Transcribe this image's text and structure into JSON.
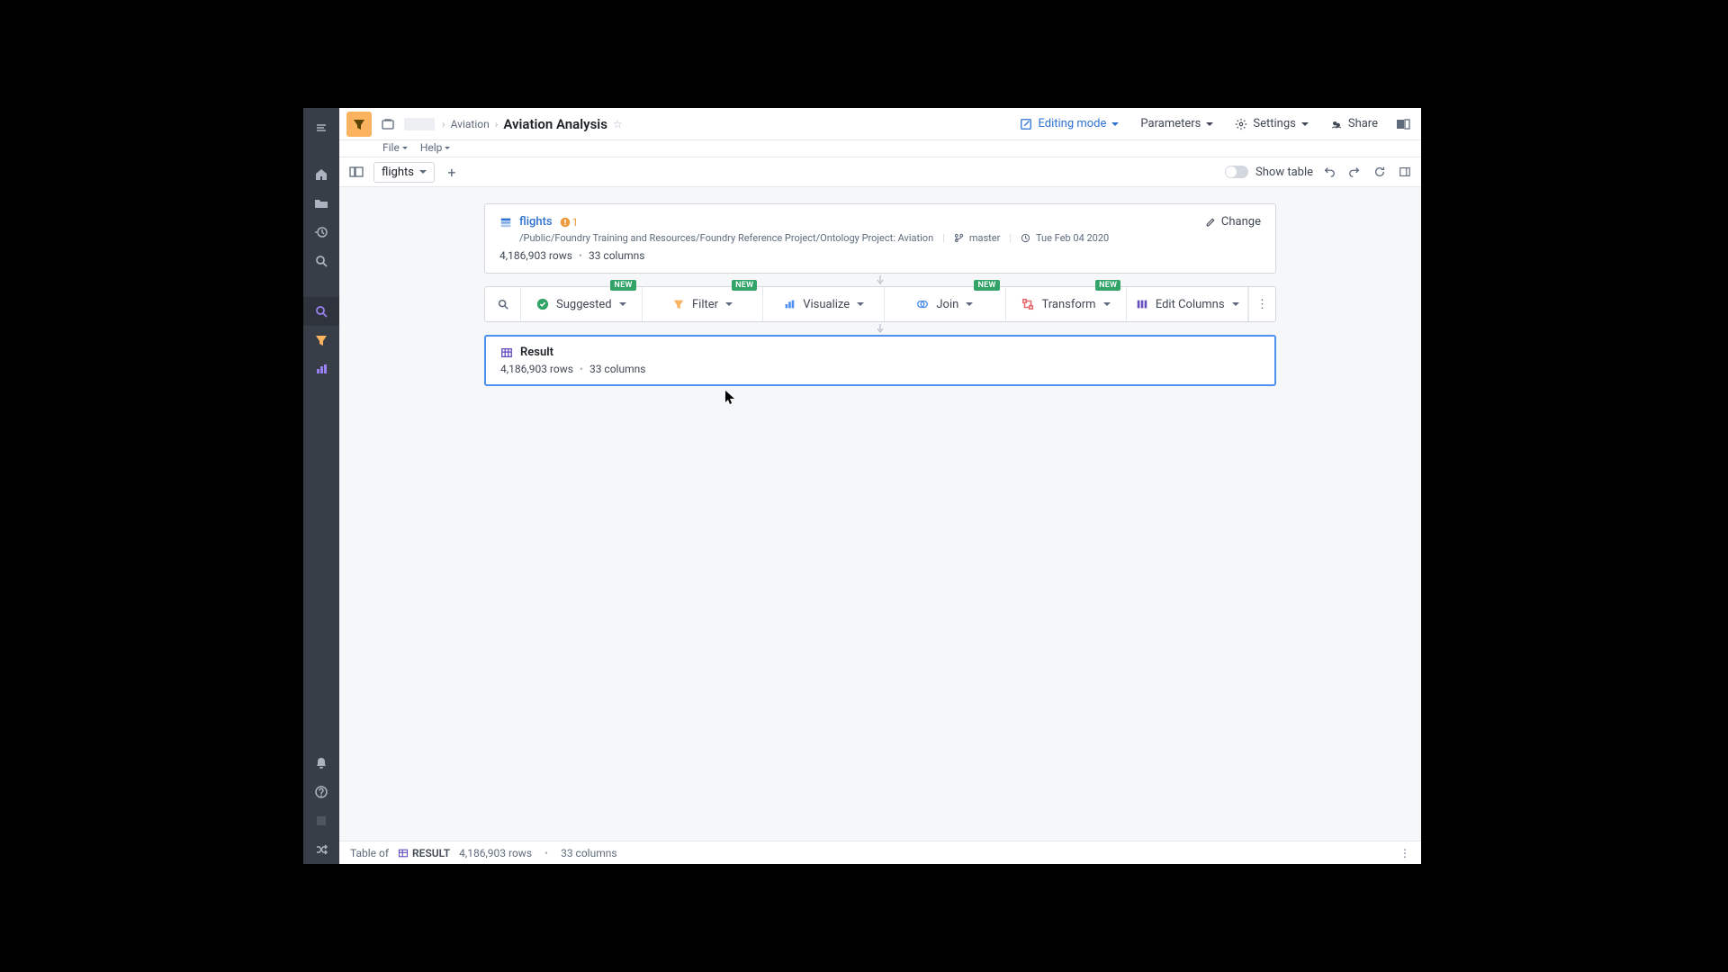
{
  "breadcrumb": {
    "parent": "Aviation",
    "title": "Aviation Analysis"
  },
  "menus": {
    "file": "File",
    "help": "Help"
  },
  "header": {
    "editing_mode": "Editing mode",
    "parameters": "Parameters",
    "settings": "Settings",
    "share": "Share"
  },
  "tabs": {
    "active": "flights",
    "show_table": "Show table"
  },
  "dataset": {
    "name": "flights",
    "warn_count": "1",
    "path": "/Public/Foundry Training and Resources/Foundry Reference Project/Ontology Project: Aviation",
    "branch": "master",
    "date": "Tue Feb 04 2020",
    "rows": "4,186,903 rows",
    "cols": "33 columns",
    "change": "Change"
  },
  "toolbar": {
    "badge": "NEW",
    "suggested": "Suggested",
    "filter": "Filter",
    "visualize": "Visualize",
    "join": "Join",
    "transform": "Transform",
    "edit_columns": "Edit Columns"
  },
  "result": {
    "title": "Result",
    "rows": "4,186,903 rows",
    "cols": "33 columns"
  },
  "footer": {
    "table_of": "Table of",
    "result": "RESULT",
    "rows": "4,186,903 rows",
    "cols": "33 columns"
  }
}
